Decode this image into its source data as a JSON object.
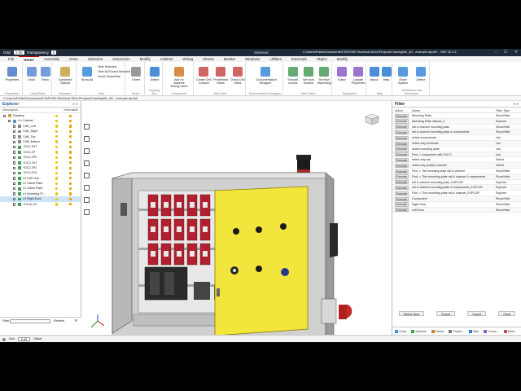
{
  "title_bar": {
    "grid_label": "Grid:",
    "grid_value": "2.00",
    "transparency_label": "Transparency",
    "transparency_value": "0",
    "selected": "Selected",
    "path": "C:\\Users\\Public\\Documents\\ETAP\\SEE Electrical 3D\\vHProjects\\Training\\file_3D - example.dpx3d* - SEE 3D 4.1"
  },
  "menu": [
    "File",
    "Home",
    "Assembly",
    "Draw",
    "Selection",
    "Dimension",
    "Modify",
    "Cabinet",
    "Wiring",
    "Sleeve",
    "Busbar",
    "Windows",
    "Utilities",
    "Externals",
    "Object",
    "Modify"
  ],
  "menu_active": "Home",
  "ribbon": {
    "groups": [
      {
        "name": "Properties",
        "buttons": [
          "Properties"
        ]
      },
      {
        "name": "Undo/Redo",
        "buttons": [
          "Undo",
          "Redo"
        ]
      },
      {
        "name": "Clipboard",
        "buttons": [
          "Combined Objects"
        ]
      },
      {
        "name": "View",
        "buttons": [
          "Show All"
        ]
      },
      {
        "name": "Sheet",
        "buttons": [
          "Sheet"
        ]
      },
      {
        "name": "Clipping box",
        "buttons": [
          "Define"
        ]
      },
      {
        "name": "Component",
        "buttons": [
          "Ask for Aspects During Insert"
        ]
      },
      {
        "name": "Drill holes",
        "buttons": [
          "Create Drill Contour",
          "Predefined Holes",
          "Check Drill Holes"
        ]
      },
      {
        "name": "Documentation Designer",
        "buttons": [
          "Documentation Designer"
        ]
      },
      {
        "name": "Wire Plans",
        "buttons": [
          "Smooth Curves",
          "Set from Surface",
          "Set from Machining"
        ]
      },
      {
        "name": "Equipment",
        "buttons": [
          "Editor",
          "Update Properties"
        ]
      },
      {
        "name": "Help",
        "buttons": [
          "About",
          "Help"
        ]
      },
      {
        "name": "Intellisense and Showroom",
        "buttons": [
          "Show System",
          "Define"
        ]
      }
    ],
    "view_small": [
      "Hide Selected",
      "Hide All Except Selected",
      "Invert Show/Hide"
    ]
  },
  "path_bar": "C:\\Users\\Public\\Documents\\ETAP\\SEE Electrical 3D\\vHProjects\\Training\\file_3D - example.dpx3d*",
  "explorer": {
    "title": "Explorer",
    "col_description": "Description",
    "col_selectable": "Selectable",
    "items": [
      {
        "label": "Drawing",
        "level": 0,
        "icon": "#d9a24a"
      },
      {
        "label": "L/c Cabinet",
        "level": 1,
        "icon": "#6a8bd0"
      },
      {
        "label": "CAB_Left",
        "level": 2,
        "icon": "#888888"
      },
      {
        "label": "CAB_Right",
        "level": 2,
        "icon": "#888888"
      },
      {
        "label": "CAB_Top",
        "level": 2,
        "icon": "#888888"
      },
      {
        "label": "CAB_Bottom",
        "level": 2,
        "icon": "#888888"
      },
      {
        "label": "+DC1-S47",
        "level": 2,
        "icon": "#3aa04a"
      },
      {
        "label": "+DC2-2P",
        "level": 2,
        "icon": "#3aa04a"
      },
      {
        "label": "+DC2-2P2",
        "level": 2,
        "icon": "#3aa04a"
      },
      {
        "label": "+DC2-2V1",
        "level": 2,
        "icon": "#3aa04a"
      },
      {
        "label": "+DC2-2P2",
        "level": 2,
        "icon": "#3aa04a"
      },
      {
        "label": "+DC2-2V4",
        "level": 2,
        "icon": "#3aa04a"
      },
      {
        "label": "L/I Left Door",
        "level": 2,
        "icon": "#3aa04a"
      },
      {
        "label": "L/I Gland Plate",
        "level": 2,
        "icon": "#3aa04a"
      },
      {
        "label": "L/I Gland Plate",
        "level": 2,
        "icon": "#3aa04a"
      },
      {
        "label": "L/I Mounting Pl...",
        "level": 2,
        "icon": "#3aa04a"
      },
      {
        "label": "L/I Right Door",
        "level": 2,
        "icon": "#3aa04a"
      },
      {
        "label": "+DC3L-S3",
        "level": 2,
        "icon": "#3aa04a"
      }
    ],
    "selected_index": 16,
    "filter_label": "Filter",
    "refresh": "Refresh"
  },
  "filter_panel": {
    "title": "Filter",
    "col_action": "Action",
    "col_name": "Name",
    "col_type": "Filter Type",
    "rows": [
      {
        "action": "Execute",
        "name": "Mounting Plate",
        "type": "Show/Hide"
      },
      {
        "action": "Execute",
        "name": "Mounting Plate without_2",
        "type": "Explorer"
      },
      {
        "action": "Execute",
        "name": "rail & channel mounting plate",
        "type": "Show/Hide"
      },
      {
        "action": "Execute",
        "name": "rail & channel mounting plate & components",
        "type": "Show/Hide"
      },
      {
        "action": "Execute",
        "name": "select components",
        "type": "List"
      },
      {
        "action": "Execute",
        "name": "select only terminals",
        "type": "List"
      },
      {
        "action": "Execute",
        "name": "select mounting plate",
        "type": "List"
      },
      {
        "action": "Execute",
        "name": "Find -> component with TAG 2",
        "type": "List"
      },
      {
        "action": "Execute",
        "name": "select only rail",
        "type": "Select"
      },
      {
        "action": "Execute",
        "name": "select only (cable) channel",
        "type": "Select"
      },
      {
        "action": "Execute",
        "name": "Find -> Tail mounting plate rail & channel",
        "type": "Show/Hide"
      },
      {
        "action": "Execute",
        "name": "Find -> This mounting plate rail & channel & components",
        "type": "Show/Hide"
      },
      {
        "action": "Execute",
        "name": "rail & channel mounting plate_EXPLOR",
        "type": "Explorer"
      },
      {
        "action": "Execute",
        "name": "rail & channel mounting plate & components_EXPLOR",
        "type": "Explorer"
      },
      {
        "action": "Execute",
        "name": "Find -> This mounting plate rail & channel_EXPLOR",
        "type": "Explorer"
      },
      {
        "action": "Execute",
        "name": "Component",
        "type": "Show/Hide"
      },
      {
        "action": "Execute",
        "name": "Right Door",
        "type": "Show/Hide"
      },
      {
        "action": "Execute",
        "name": "Left Door",
        "type": "Show/Hide"
      }
    ],
    "buttons": [
      "Define New",
      "Export",
      "Import",
      "Clear"
    ],
    "tabs": [
      {
        "label": "Comp",
        "color": "#3a8ad8"
      },
      {
        "label": "Symbols",
        "color": "#3aa04a"
      },
      {
        "label": "Planes",
        "color": "#d07a2a"
      },
      {
        "label": "Proper...",
        "color": "#777777"
      },
      {
        "label": "Filter",
        "color": "#2a7ad0"
      },
      {
        "label": "Comm...",
        "color": "#8a5ac8"
      },
      {
        "label": "Wires",
        "color": "#c84a4a"
      }
    ]
  },
  "status_bar": {
    "grid_label": "Grid",
    "grid_value": "5.00",
    "offset_label": "Offset"
  },
  "colors": {
    "accent": "#c00000",
    "door_yellow": "#f2e53c",
    "cabinet_gray": "#c8c8c8",
    "breaker_red": "#b02030"
  }
}
